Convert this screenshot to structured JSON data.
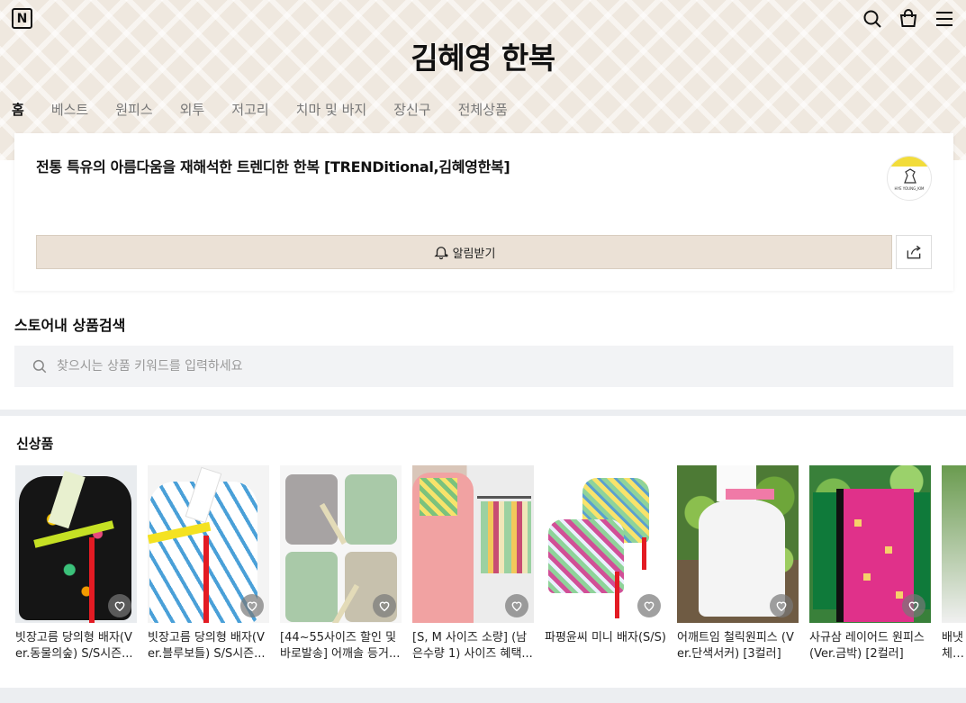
{
  "store": {
    "title": "김혜영 한복",
    "description": "전통 특유의 아름다움을 재해석한 트렌디한 한복 [TRENDitional,김혜영한복]",
    "avatar_text": "HYE YOUNG_KIM"
  },
  "header": {
    "logo_letter": "N",
    "icons": [
      "search-icon",
      "shopping-bag-icon",
      "menu-icon"
    ]
  },
  "nav": {
    "items": [
      {
        "label": "홈",
        "active": true
      },
      {
        "label": "베스트",
        "active": false
      },
      {
        "label": "원피스",
        "active": false
      },
      {
        "label": "외투",
        "active": false
      },
      {
        "label": "저고리",
        "active": false
      },
      {
        "label": "치마 및 바지",
        "active": false
      },
      {
        "label": "장신구",
        "active": false
      },
      {
        "label": "전체상품",
        "active": false
      }
    ]
  },
  "actions": {
    "notify_label": "알림받기"
  },
  "search": {
    "heading": "스토어내 상품검색",
    "placeholder": "찾으시는 상품 키워드를 입력하세요"
  },
  "new_products": {
    "heading": "신상품",
    "items": [
      {
        "name": "빗장고름 당의형 배자(Ver.동물의숲) S/S시즌..."
      },
      {
        "name": "빗장고름 당의형 배자(Ver.블루보틀) S/S시즌..."
      },
      {
        "name": "[44~55사이즈 할인 및 바로발송] 어깨솔 등거..."
      },
      {
        "name": "[S, M 사이즈 소량] (남은수량 1) 사이즈 혜택..."
      },
      {
        "name": "파평윤씨 미니 배자(S/S)"
      },
      {
        "name": "어깨트임 철릭원피스 (Ver.단색서커) [3컬러]"
      },
      {
        "name": "사규삼 레이어드 원피스 (Ver.금박) [2컬러]"
      },
      {
        "name": "배냇체크..."
      }
    ]
  },
  "colors": {
    "hero_bg": "#efe8df",
    "notify_bg": "#ebe1d6",
    "search_bg": "#f2f3f5"
  }
}
